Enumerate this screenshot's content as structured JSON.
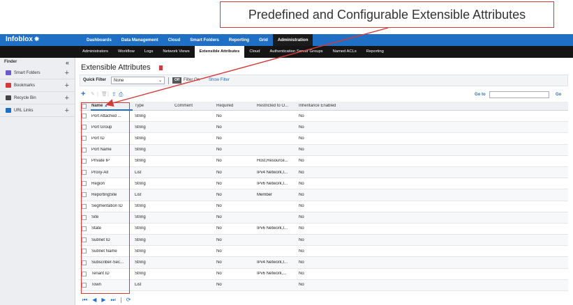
{
  "callout": {
    "text": "Predefined and Configurable Extensible Attributes"
  },
  "brand": {
    "name": "Infoblox",
    "mark": "✵"
  },
  "nav": {
    "items": [
      "Dashboards",
      "Data Management",
      "Cloud",
      "Smart Folders",
      "Reporting",
      "Grid",
      "Administration"
    ],
    "active_index": 6
  },
  "subnav": {
    "items": [
      "Administrators",
      "Workflow",
      "Logs",
      "Network Views",
      "Extensible Attributes",
      "Cloud",
      "Authentication Server Groups",
      "Named ACLs",
      "Reporting"
    ],
    "active_index": 4
  },
  "sidebar": {
    "title": "Finder",
    "collapse_icon": "«",
    "items": [
      {
        "label": "Smart Folders",
        "icon": "folder-icon",
        "color": "#6a5acd"
      },
      {
        "label": "Bookmarks",
        "icon": "bookmark-icon",
        "color": "#d23b3b"
      },
      {
        "label": "Recycle Bin",
        "icon": "trash-icon",
        "color": "#444444"
      },
      {
        "label": "URL Links",
        "icon": "link-icon",
        "color": "#1f6fc5"
      }
    ]
  },
  "page": {
    "title": "Extensible Attributes",
    "quick_filter_label": "Quick Filter",
    "quick_filter_value": "None",
    "toggle_text": "Off",
    "filter_on_text": "Filter On",
    "show_filter_text": "Show Filter",
    "goto_label": "Go to",
    "goto_button": "Go"
  },
  "table": {
    "columns": [
      "Name",
      "Type",
      "Comment",
      "Required",
      "Restricted to O...",
      "Inheritance Enabled"
    ],
    "sort_indicator": "▲",
    "rows": [
      [
        "Port Attached ...",
        "String",
        "",
        "No",
        "",
        "No"
      ],
      [
        "Port Group",
        "String",
        "",
        "No",
        "",
        "No"
      ],
      [
        "Port ID",
        "String",
        "",
        "No",
        "",
        "No"
      ],
      [
        "Port Name",
        "String",
        "",
        "No",
        "",
        "No"
      ],
      [
        "Private IP",
        "String",
        "",
        "No",
        "Host,Resource...",
        "No"
      ],
      [
        "Proxy-All",
        "List",
        "",
        "No",
        "IPv4 Network,I...",
        "No"
      ],
      [
        "Region",
        "String",
        "",
        "No",
        "IPv6 Network,I...",
        "No"
      ],
      [
        "ReportingSite",
        "List",
        "",
        "No",
        "Member",
        "No"
      ],
      [
        "Segmentation ID",
        "String",
        "",
        "No",
        "",
        "No"
      ],
      [
        "Site",
        "String",
        "",
        "No",
        "",
        "No"
      ],
      [
        "State",
        "String",
        "",
        "No",
        "IPv6 Network,I...",
        "No"
      ],
      [
        "Subnet ID",
        "String",
        "",
        "No",
        "",
        "No"
      ],
      [
        "Subnet Name",
        "String",
        "",
        "No",
        "",
        "No"
      ],
      [
        "Subscriber-Sec...",
        "String",
        "",
        "No",
        "IPv4 Network,I...",
        "No"
      ],
      [
        "Tenant ID",
        "String",
        "",
        "No",
        "IPv6 Network,...",
        "No"
      ],
      [
        "Town",
        "List",
        "",
        "No",
        "",
        "No"
      ]
    ]
  },
  "colors": {
    "accent": "#1f6fc5",
    "highlight": "#d43a3a",
    "nav_dark": "#151515"
  }
}
